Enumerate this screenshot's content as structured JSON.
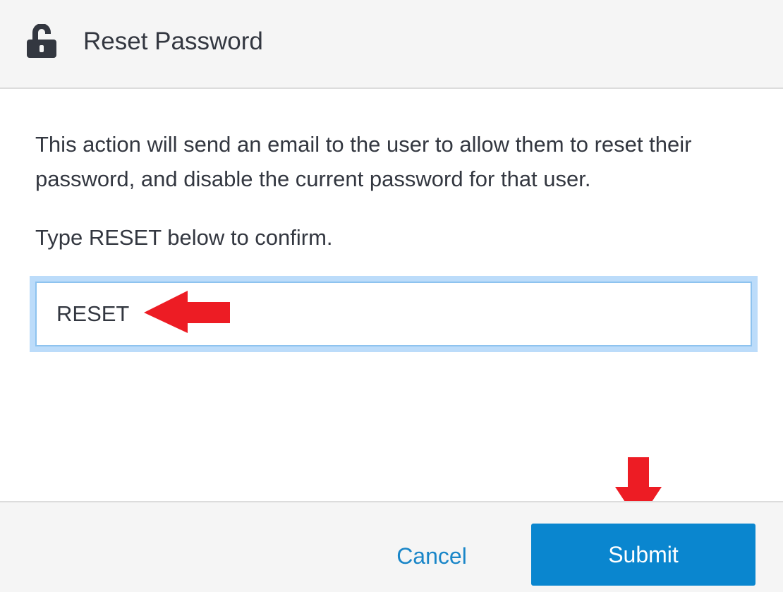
{
  "header": {
    "icon": "unlocked-padlock-icon",
    "title": "Reset Password"
  },
  "body": {
    "description": "This action will send an email to the user to allow them to reset their password, and disable the current password for that user.",
    "confirm_instruction": "Type RESET below to confirm."
  },
  "confirm_input": {
    "value": "RESET",
    "focused": true
  },
  "annotations": {
    "arrow_to_input": "red-left-arrow-icon",
    "arrow_to_submit": "red-down-arrow-icon",
    "color": "#ed1c24"
  },
  "footer": {
    "cancel_label": "Cancel",
    "submit_label": "Submit"
  },
  "colors": {
    "header_bg": "#f5f5f5",
    "text": "#333740",
    "link_blue": "#1a86c8",
    "primary_button": "#0a86cf",
    "focus_ring": "#bcdcfa"
  }
}
